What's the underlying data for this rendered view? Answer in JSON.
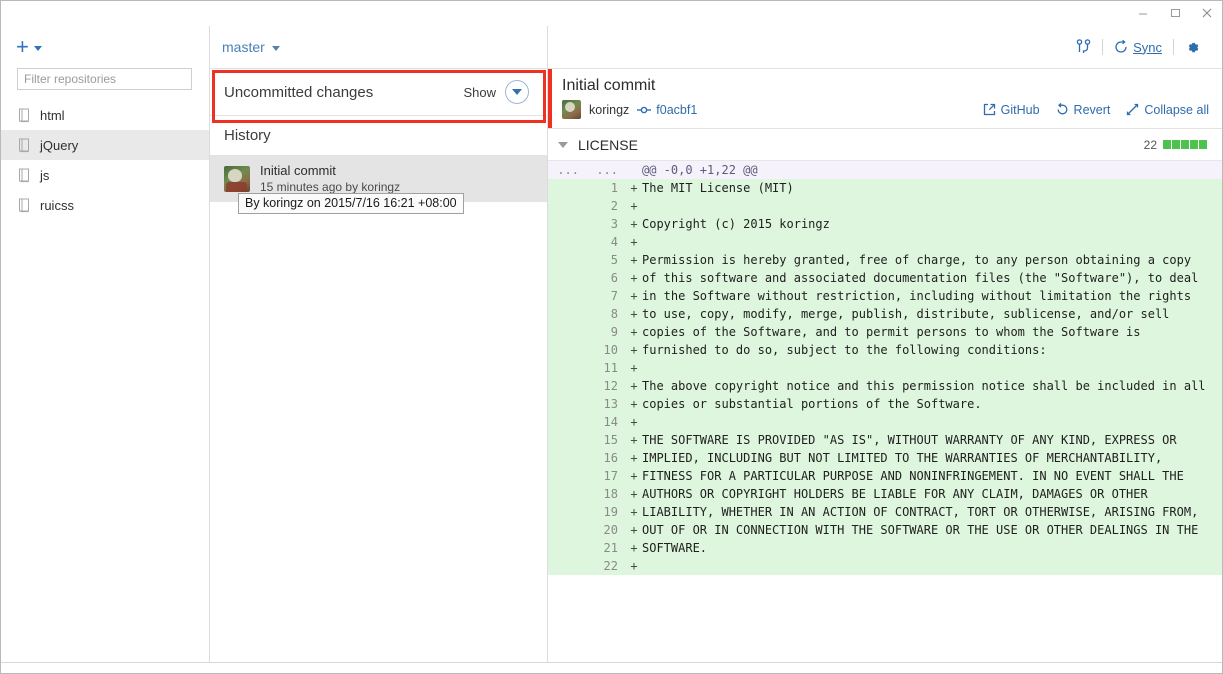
{
  "window": {
    "controls": [
      {
        "name": "minimize",
        "glyph": "–"
      },
      {
        "name": "maximize",
        "glyph": "☐"
      },
      {
        "name": "close",
        "glyph": "✕"
      }
    ]
  },
  "sidebar": {
    "add_button": {
      "glyph": "+",
      "label": "Add repository"
    },
    "filter": {
      "value": "",
      "placeholder": "Filter repositories"
    },
    "repositories": [
      {
        "name": "html",
        "selected": false
      },
      {
        "name": "jQuery",
        "selected": true
      },
      {
        "name": "js",
        "selected": false
      },
      {
        "name": "ruicss",
        "selected": false
      }
    ]
  },
  "middle": {
    "branch": "master",
    "uncommitted": {
      "label": "Uncommitted changes",
      "show_label": "Show"
    },
    "history_header": "History",
    "commits": [
      {
        "title": "Initial commit",
        "subtitle": "15 minutes ago by koringz",
        "selected": true
      }
    ],
    "tooltip": "By koringz on 2015/7/16 16:21 +08:00"
  },
  "toolbar": {
    "branch_icon_label": "branch",
    "sync_label": "Sync",
    "sync_accesskey": "S",
    "settings_label": "Settings"
  },
  "commit_detail": {
    "title": "Initial commit",
    "author": "koringz",
    "sha": "f0acbf1",
    "actions": [
      {
        "name": "github",
        "label": "GitHub"
      },
      {
        "name": "revert",
        "label": "Revert"
      },
      {
        "name": "collapse-all",
        "label": "Collapse all"
      }
    ]
  },
  "file": {
    "name": "LICENSE",
    "change_count": "22",
    "blocks": [
      "on",
      "on",
      "on",
      "on",
      "on"
    ]
  },
  "diff": {
    "hunk": {
      "old_gutter": "...",
      "new_gutter": "...",
      "text": "@@ -0,0 +1,22 @@"
    },
    "lines": [
      {
        "n": "1",
        "sign": "+",
        "text": "The MIT License (MIT)"
      },
      {
        "n": "2",
        "sign": "+",
        "text": ""
      },
      {
        "n": "3",
        "sign": "+",
        "text": "Copyright (c) 2015 koringz"
      },
      {
        "n": "4",
        "sign": "+",
        "text": ""
      },
      {
        "n": "5",
        "sign": "+",
        "text": "Permission is hereby granted, free of charge, to any person obtaining a copy"
      },
      {
        "n": "6",
        "sign": "+",
        "text": "of this software and associated documentation files (the \"Software\"), to deal"
      },
      {
        "n": "7",
        "sign": "+",
        "text": "in the Software without restriction, including without limitation the rights"
      },
      {
        "n": "8",
        "sign": "+",
        "text": "to use, copy, modify, merge, publish, distribute, sublicense, and/or sell"
      },
      {
        "n": "9",
        "sign": "+",
        "text": "copies of the Software, and to permit persons to whom the Software is"
      },
      {
        "n": "10",
        "sign": "+",
        "text": "furnished to do so, subject to the following conditions:"
      },
      {
        "n": "11",
        "sign": "+",
        "text": ""
      },
      {
        "n": "12",
        "sign": "+",
        "text": "The above copyright notice and this permission notice shall be included in all"
      },
      {
        "n": "13",
        "sign": "+",
        "text": "copies or substantial portions of the Software."
      },
      {
        "n": "14",
        "sign": "+",
        "text": ""
      },
      {
        "n": "15",
        "sign": "+",
        "text": "THE SOFTWARE IS PROVIDED \"AS IS\", WITHOUT WARRANTY OF ANY KIND, EXPRESS OR"
      },
      {
        "n": "16",
        "sign": "+",
        "text": "IMPLIED, INCLUDING BUT NOT LIMITED TO THE WARRANTIES OF MERCHANTABILITY,"
      },
      {
        "n": "17",
        "sign": "+",
        "text": "FITNESS FOR A PARTICULAR PURPOSE AND NONINFRINGEMENT. IN NO EVENT SHALL THE"
      },
      {
        "n": "18",
        "sign": "+",
        "text": "AUTHORS OR COPYRIGHT HOLDERS BE LIABLE FOR ANY CLAIM, DAMAGES OR OTHER"
      },
      {
        "n": "19",
        "sign": "+",
        "text": "LIABILITY, WHETHER IN AN ACTION OF CONTRACT, TORT OR OTHERWISE, ARISING FROM,"
      },
      {
        "n": "20",
        "sign": "+",
        "text": "OUT OF OR IN CONNECTION WITH THE SOFTWARE OR THE USE OR OTHER DEALINGS IN THE"
      },
      {
        "n": "21",
        "sign": "+",
        "text": "SOFTWARE."
      },
      {
        "n": "22",
        "sign": "+",
        "text": ""
      }
    ]
  },
  "colors": {
    "accent_blue": "#2f6cad",
    "highlight_red": "#ef3124",
    "addition_green_bg": "#ddf6dd",
    "block_green": "#4ec24e",
    "selected_row": "#e4e4e4"
  }
}
